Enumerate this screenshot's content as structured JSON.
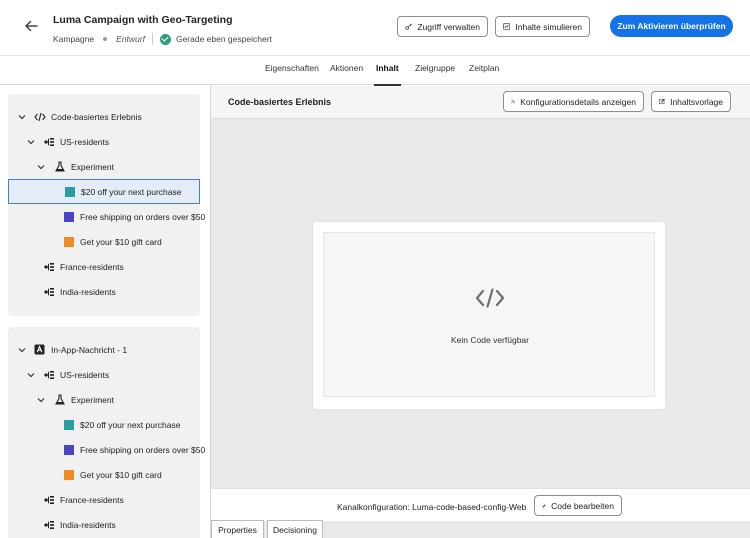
{
  "header": {
    "title": "Luma Campaign with Geo-Targeting",
    "type": "Kampagne",
    "status": "Entwurf",
    "saved": "Gerade eben gespeichert",
    "access_button": "Zugriff verwalten",
    "simulate_button": "Inhalte simulieren",
    "primary_button": "Zum Aktivieren überprüfen"
  },
  "tabs": [
    "Eigenschaften",
    "Aktionen",
    "Inhalt",
    "Zielgruppe",
    "Zeitplan"
  ],
  "left": {
    "card1": {
      "root": "Code-basiertes Erlebnis",
      "items": [
        {
          "label": "US-residents"
        },
        {
          "label": "Experiment"
        },
        {
          "label": "$20 off your next purchase",
          "color": "#2a9d9f"
        },
        {
          "label": "Free shipping on orders over $50",
          "color": "#4a44c6"
        },
        {
          "label": "Get your $10 gift card",
          "color": "#f08a24"
        },
        {
          "label": "France-residents"
        },
        {
          "label": "India-residents"
        }
      ]
    },
    "card2": {
      "root": "In-App-Nachricht - 1",
      "items": [
        {
          "label": "US-residents"
        },
        {
          "label": "Experiment"
        },
        {
          "label": "$20 off your next purchase",
          "color": "#2a9d9f"
        },
        {
          "label": "Free shipping on orders over $50",
          "color": "#4a44c6"
        },
        {
          "label": "Get your $10 gift card",
          "color": "#f08a24"
        },
        {
          "label": "France-residents"
        },
        {
          "label": "India-residents"
        }
      ]
    }
  },
  "right": {
    "title": "Code-basiertes Erlebnis",
    "config_button": "Konfigurationsdetails anzeigen",
    "template_button": "Inhaltsvorlage",
    "empty_text": "Kein Code verfügbar",
    "channel_config": "Kanalkonfiguration: Luma-code-based-config-Web",
    "edit_code_button": "Code bearbeiten",
    "bottom_tabs": [
      "Properties",
      "Decisioning"
    ]
  },
  "colors": {
    "accent": "#1473e6",
    "selection": "#e3ecf7",
    "success": "#2d9d78"
  }
}
